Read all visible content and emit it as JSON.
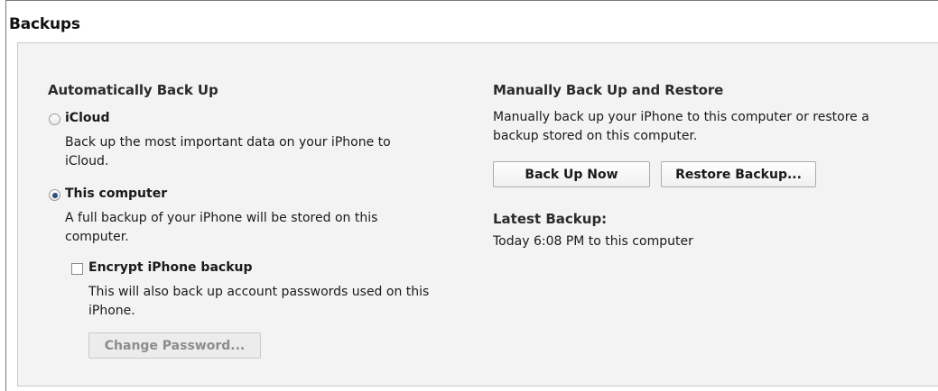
{
  "section": {
    "title": "Backups"
  },
  "auto": {
    "heading": "Automatically Back Up",
    "icloud": {
      "label": "iCloud",
      "desc_lines": [
        "Back up the most important data on your iPhone to",
        "iCloud."
      ],
      "selected": false
    },
    "computer": {
      "label": "This computer",
      "desc_lines": [
        "A full backup of your iPhone will be stored on this",
        "computer."
      ],
      "selected": true
    },
    "encrypt": {
      "label": "Encrypt iPhone backup",
      "desc_lines": [
        "This will also back up account passwords used on this",
        "iPhone."
      ],
      "checked": false
    },
    "change_password_label": "Change Password..."
  },
  "manual": {
    "heading": "Manually Back Up and Restore",
    "desc_lines": [
      "Manually back up your iPhone to this computer or restore a",
      "backup stored on this computer."
    ],
    "back_up_now_label": "Back Up Now",
    "restore_label": "Restore Backup...",
    "latest_label": "Latest Backup:",
    "latest_value": "Today 6:08 PM to this computer"
  },
  "colors": {
    "panel_bg": "#f3f3f3",
    "radio_dot": "#2c4f7a",
    "disabled_text": "#8c8c8c"
  }
}
